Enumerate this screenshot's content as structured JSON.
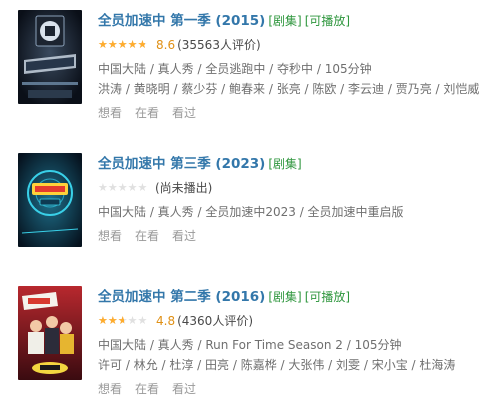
{
  "items": [
    {
      "title": "全员加速中 第一季 (2015)",
      "tag_type": "[剧集]",
      "tag_play": "[可播放]",
      "score": "8.6",
      "rating_fraction": 0.86,
      "rating_count": "(35563人评价)",
      "meta_line1": "中国大陆 / 真人秀 / 全员逃跑中 / 夺秒中 / 105分钟",
      "meta_line2": "洪涛 / 黄晓明 / 蔡少芬 / 鲍春来 / 张亮 / 陈欧 / 李云迪 / 贾乃亮 / 刘恺威",
      "actions": [
        "想看",
        "在看",
        "看过"
      ]
    },
    {
      "title": "全员加速中 第三季 (2023)",
      "tag_type": "[剧集]",
      "rating_fraction": 0,
      "rating_count": "(尚未播出)",
      "meta_line1": "中国大陆 / 真人秀 / 全员加速中2023 / 全员加速中重启版",
      "actions": [
        "想看",
        "在看",
        "看过"
      ]
    },
    {
      "title": "全员加速中 第二季 (2016)",
      "tag_type": "[剧集]",
      "tag_play": "[可播放]",
      "score": "4.8",
      "rating_fraction": 0.48,
      "rating_count": "(4360人评价)",
      "meta_line1": "中国大陆 / 真人秀 / Run For Time Season 2 / 105分钟",
      "meta_line2": "许可 / 林允 / 杜淳 / 田亮 / 陈嘉桦 / 大张伟 / 刘雯 / 宋小宝 / 杜海涛",
      "actions": [
        "想看",
        "在看",
        "看过"
      ]
    }
  ],
  "colors": {
    "title": "#3377aa",
    "tag": "#2e963d",
    "star": "#ffac2d",
    "score": "#e09015",
    "meta": "#6f6f6f",
    "action": "#999999"
  }
}
